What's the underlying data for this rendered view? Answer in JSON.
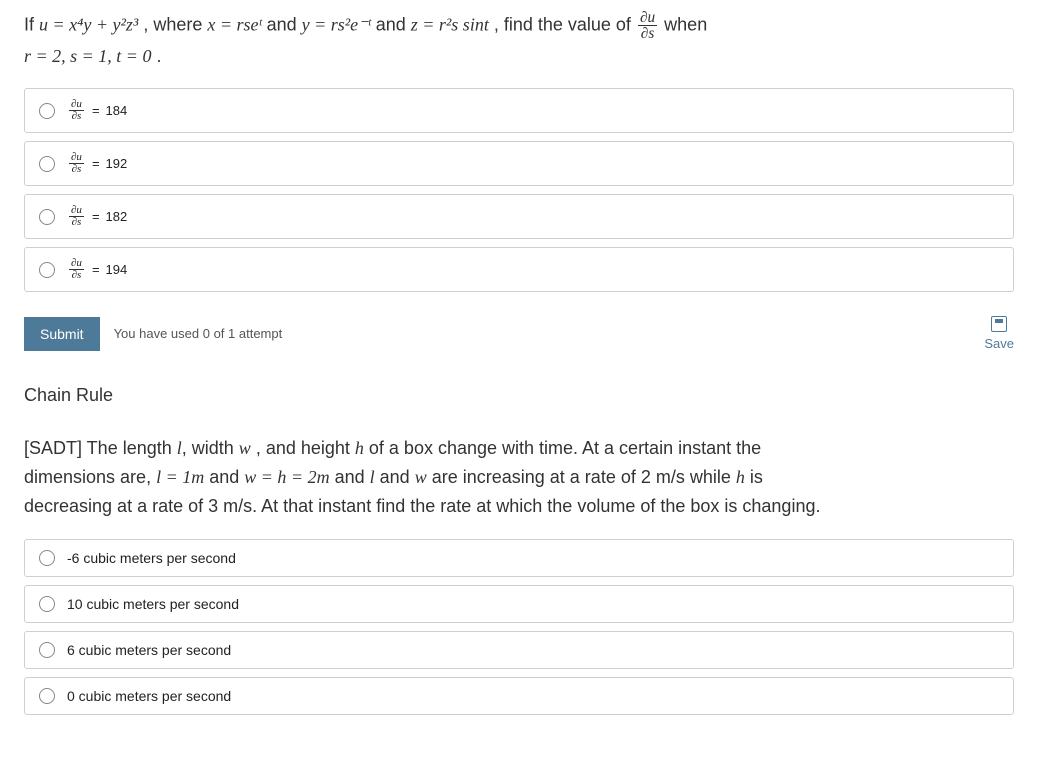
{
  "q1": {
    "prompt_parts": {
      "p1": "If ",
      "p2": ", where ",
      "p3": " and ",
      "p4": " and ",
      "p5": ",  find the value of ",
      "p6": " when",
      "p7": "."
    },
    "expr_u": "u = x⁴y + y²z³",
    "expr_x": "x = rseᵗ",
    "expr_y": "y = rs²e⁻ᵗ",
    "expr_z": "z = r²s sint",
    "frac_num": "∂u",
    "frac_den": "∂s",
    "cond": "r = 2, s = 1, t = 0",
    "options": [
      {
        "num": "∂u",
        "den": "∂s",
        "val": "184"
      },
      {
        "num": "∂u",
        "den": "∂s",
        "val": "192"
      },
      {
        "num": "∂u",
        "den": "∂s",
        "val": "182"
      },
      {
        "num": "∂u",
        "den": "∂s",
        "val": "194"
      }
    ]
  },
  "actions": {
    "submit": "Submit",
    "attempts": "You have used 0 of 1 attempt",
    "save": "Save"
  },
  "section": "Chain Rule",
  "q2": {
    "line1a": "[SADT] The length ",
    "l": "l",
    "line1b": ", width ",
    "w": "w",
    "line1c": " , and height ",
    "h": "h",
    "line1d": " of a box change with time. At a certain instant the",
    "line2a": "dimensions are, ",
    "dim_l": "l = 1m",
    "line2b": " and ",
    "dim_wh": "w = h = 2m",
    "line2c": " and ",
    "line2d": " and ",
    "line2e": " are increasing at a rate of 2 m/s while ",
    "line2f": " is",
    "line3": "decreasing at a rate of 3 m/s. At that instant find the rate at which the volume of the box is changing.",
    "options": [
      "-6 cubic meters per second",
      "10 cubic meters per second",
      "6 cubic meters per second",
      "0 cubic meters per second"
    ]
  }
}
